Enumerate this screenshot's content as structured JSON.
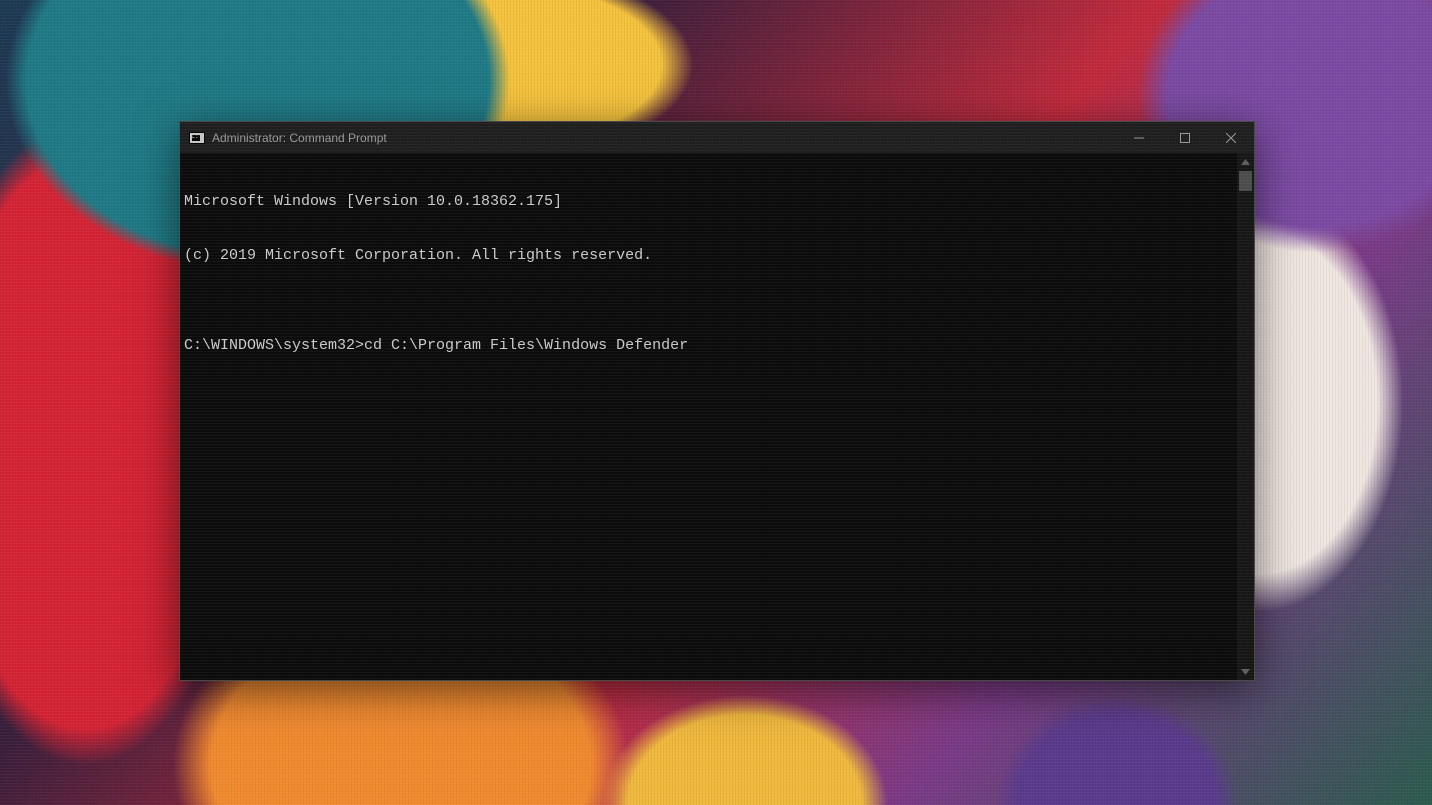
{
  "window": {
    "title": "Administrator: Command Prompt"
  },
  "console": {
    "lines": [
      "Microsoft Windows [Version 10.0.18362.175]",
      "(c) 2019 Microsoft Corporation. All rights reserved.",
      "",
      "C:\\WINDOWS\\system32>cd C:\\Program Files\\Windows Defender"
    ]
  }
}
